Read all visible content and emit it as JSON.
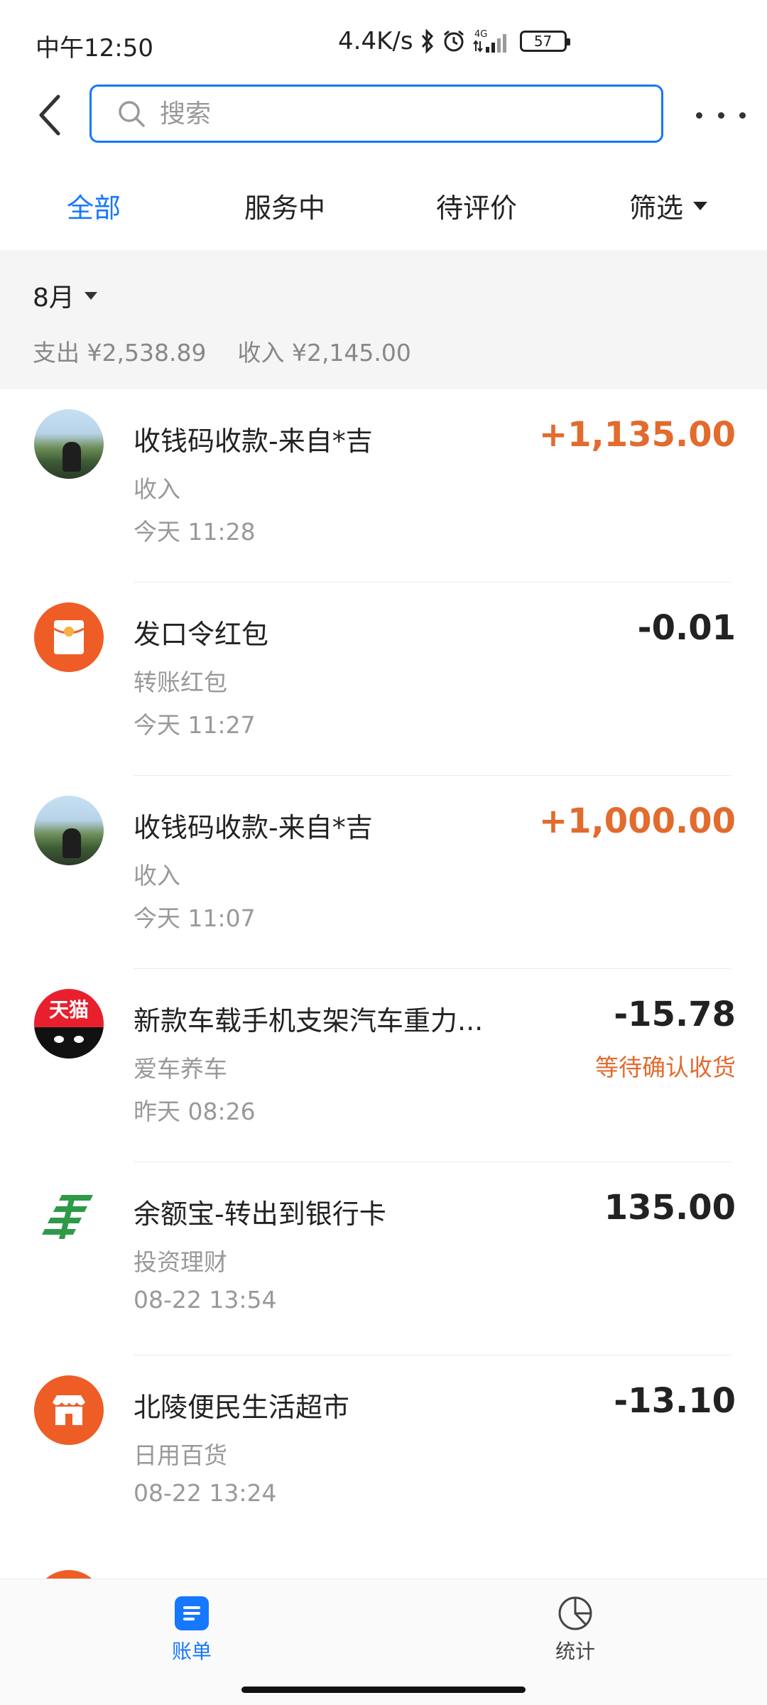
{
  "status_bar": {
    "time": "中午12:50",
    "net_speed": "4.4K/s",
    "network_type": "4G",
    "battery": "57"
  },
  "top_nav": {
    "search_placeholder": "搜索"
  },
  "tabs": [
    {
      "label": "全部",
      "active": true
    },
    {
      "label": "服务中",
      "active": false
    },
    {
      "label": "待评价",
      "active": false
    },
    {
      "label": "筛选",
      "active": false
    }
  ],
  "summary": {
    "month": "8月",
    "expense_label": "支出",
    "expense_value": "¥2,538.89",
    "income_label": "收入",
    "income_value": "¥2,145.00"
  },
  "transactions": [
    {
      "title": "收钱码收款-来自*吉",
      "category": "收入",
      "time": "今天  11:28",
      "amount": "+1,135.00",
      "status": "",
      "icon": "user-avatar-photo"
    },
    {
      "title": "发口令红包",
      "category": "转账红包",
      "time": "今天  11:27",
      "amount": "-0.01",
      "status": "",
      "icon": "red-packet-icon"
    },
    {
      "title": "收钱码收款-来自*吉",
      "category": "收入",
      "time": "今天  11:07",
      "amount": "+1,000.00",
      "status": "",
      "icon": "user-avatar-photo"
    },
    {
      "title": "新款车载手机支架汽车重力...",
      "category": "爱车养车",
      "time": "昨天  08:26",
      "amount": "-15.78",
      "status": "等待确认收货",
      "icon": "tmall-icon",
      "icon_text": "天猫"
    },
    {
      "title": "余额宝-转出到银行卡",
      "category": "投资理财",
      "time": "08-22  13:54",
      "amount": "135.00",
      "status": "",
      "icon": "postal-bank-icon"
    },
    {
      "title": "北陵便民生活超市",
      "category": "日用百货",
      "time": "08-22  13:24",
      "amount": "-13.10",
      "status": "",
      "icon": "store-icon"
    }
  ],
  "bottom_nav": {
    "bill_label": "账单",
    "stats_label": "统计"
  },
  "colors": {
    "accent": "#1677ff",
    "income": "#e26b2e",
    "brand_orange": "#ee5d26",
    "tmall_red": "#e8202e",
    "postal_green": "#2e9a48"
  }
}
